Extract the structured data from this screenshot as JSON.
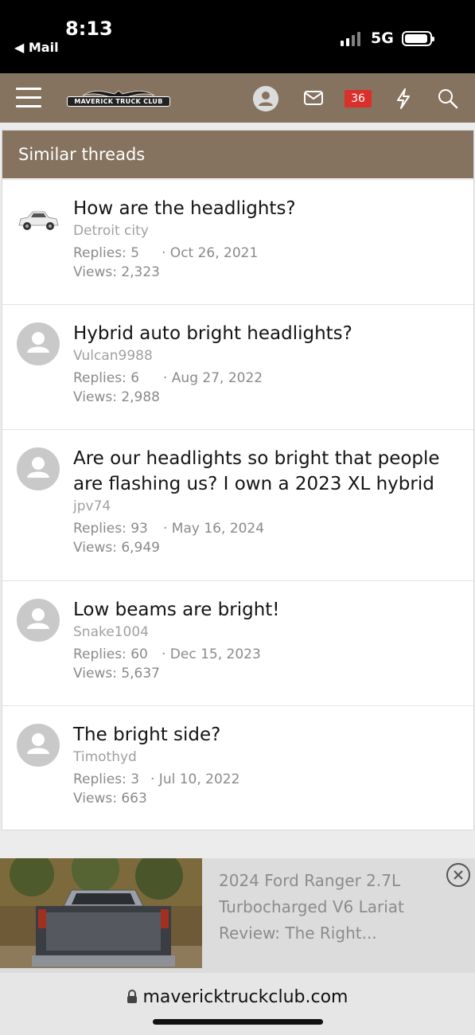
{
  "status_bar": {
    "time": "8:13",
    "back_label": "◀ Mail",
    "network": "5G"
  },
  "nav": {
    "logo_text": "MAVERICK TRUCK CLUB",
    "alerts_count": "36"
  },
  "section": {
    "title": "Similar threads"
  },
  "threads": [
    {
      "title": "How are the headlights?",
      "author": "Detroit city",
      "replies": "Replies: 5",
      "date": "· Oct 26, 2021",
      "views": "Views: 2,323"
    },
    {
      "title": "Hybrid auto bright headlights?",
      "author": "Vulcan9988",
      "replies": "Replies: 6",
      "date": "· Aug 27, 2022",
      "views": "Views: 2,988"
    },
    {
      "title": "Are our headlights so bright that people are flashing us? I own a 2023 XL hybrid",
      "author": "jpv74",
      "replies": "Replies: 93",
      "date": "· May 16, 2024",
      "views": "Views: 6,949"
    },
    {
      "title": "Low beams are bright!",
      "author": "Snake1004",
      "replies": "Replies: 60",
      "date": "· Dec 15, 2023",
      "views": "Views: 5,637"
    },
    {
      "title": "The bright side?",
      "author": "Timothyd",
      "replies": "Replies: 3",
      "date": "· Jul 10, 2022",
      "views": "Views: 663"
    }
  ],
  "ad": {
    "text": "2024 Ford Ranger 2.7L Turbocharged V6 Lariat Review: The Right..."
  },
  "browser": {
    "url": "mavericktruckclub.com"
  },
  "colors": {
    "nav_bg": "#85735f",
    "badge_bg": "#d9302c"
  }
}
